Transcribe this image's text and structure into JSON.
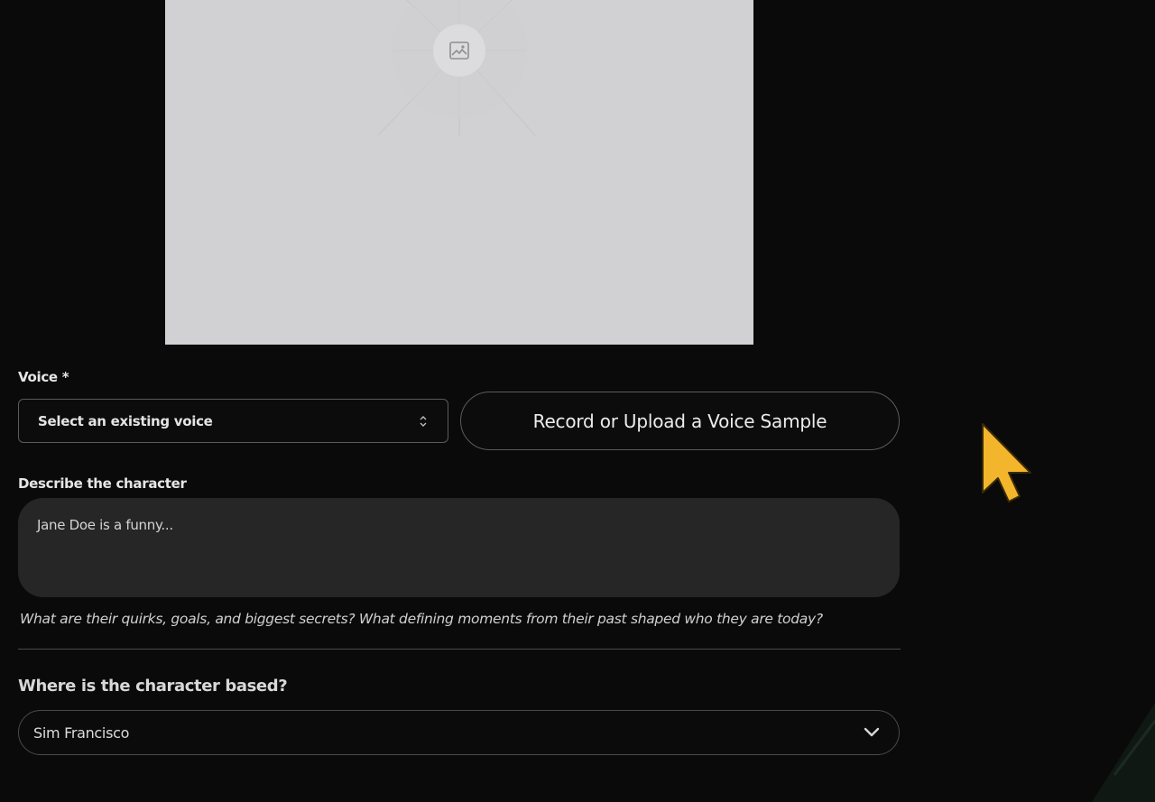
{
  "image_upload": {
    "icon": "image-icon"
  },
  "voice": {
    "label": "Voice *",
    "select_value": "Select an existing voice",
    "record_button_label": "Record or Upload a Voice Sample"
  },
  "description": {
    "label": "Describe the character",
    "placeholder": "Jane Doe is a funny...",
    "helper": "What are their quirks, goals, and biggest secrets? What defining moments from their past shaped who they are today?"
  },
  "location": {
    "label": "Where is the character based?",
    "select_value": "Sim Francisco"
  },
  "colors": {
    "background": "#0a0a0a",
    "placeholder_bg": "#d1d0d2",
    "cursor": "#f3b52c"
  }
}
